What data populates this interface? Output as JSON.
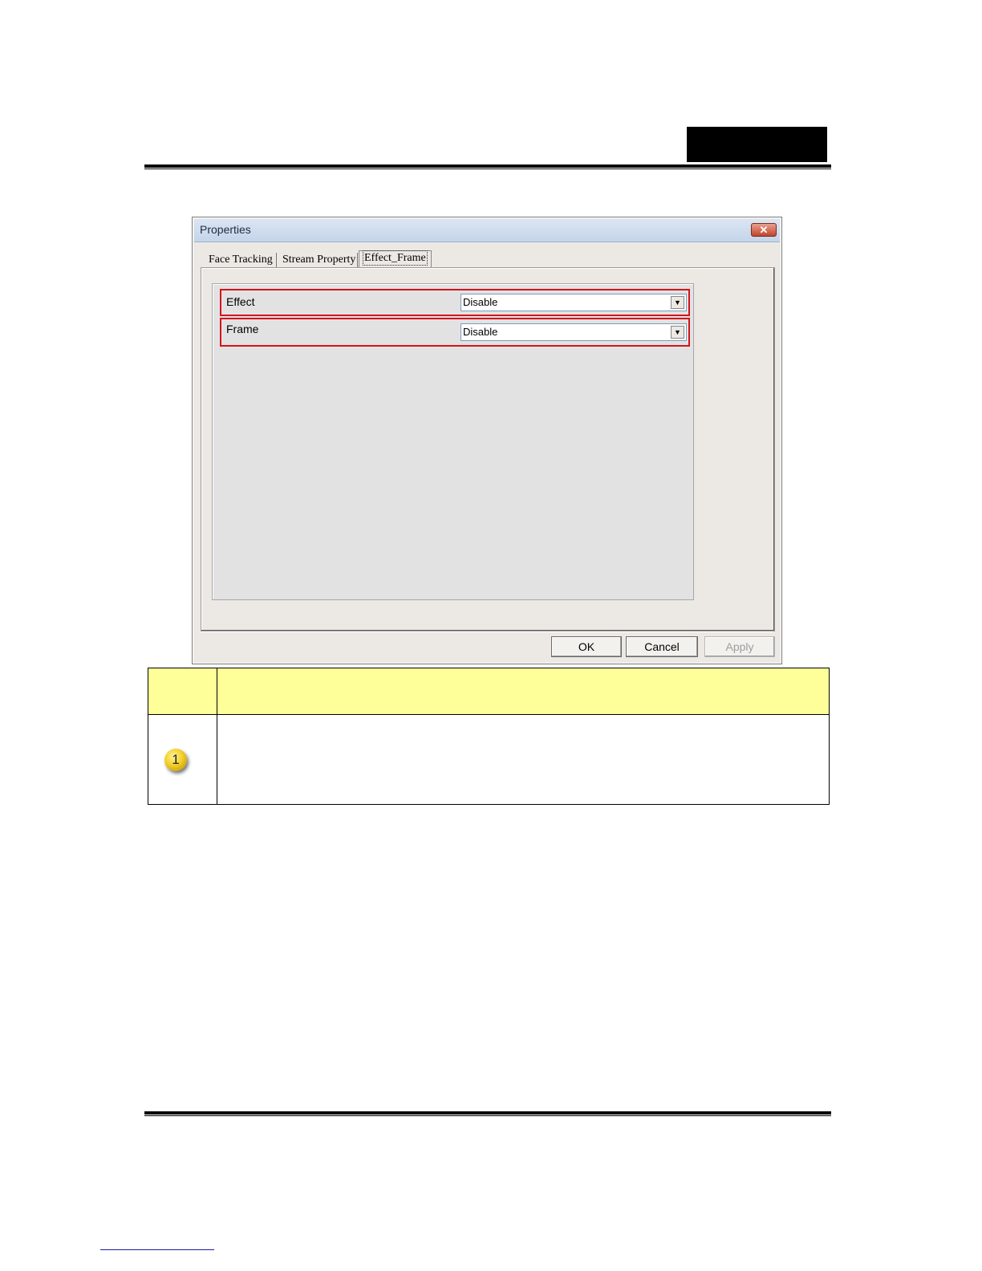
{
  "dialog": {
    "title": "Properties",
    "close_glyph": "✕",
    "tabs": [
      {
        "label": "Face Tracking"
      },
      {
        "label": "Stream Property"
      },
      {
        "label": "Effect_Frame"
      }
    ],
    "active_tab": "Effect_Frame",
    "fields": [
      {
        "label": "Effect",
        "value": "Disable"
      },
      {
        "label": "Frame",
        "value": "Disable"
      }
    ],
    "dropdown_glyph": "▼",
    "buttons": {
      "ok": "OK",
      "cancel": "Cancel",
      "apply": "Apply"
    }
  },
  "table": {
    "rows": [
      {
        "marker": "1"
      }
    ]
  },
  "colors": {
    "highlight_border": "#d3141c",
    "table_header": "#ffff99",
    "badge": "#f3cf27"
  }
}
